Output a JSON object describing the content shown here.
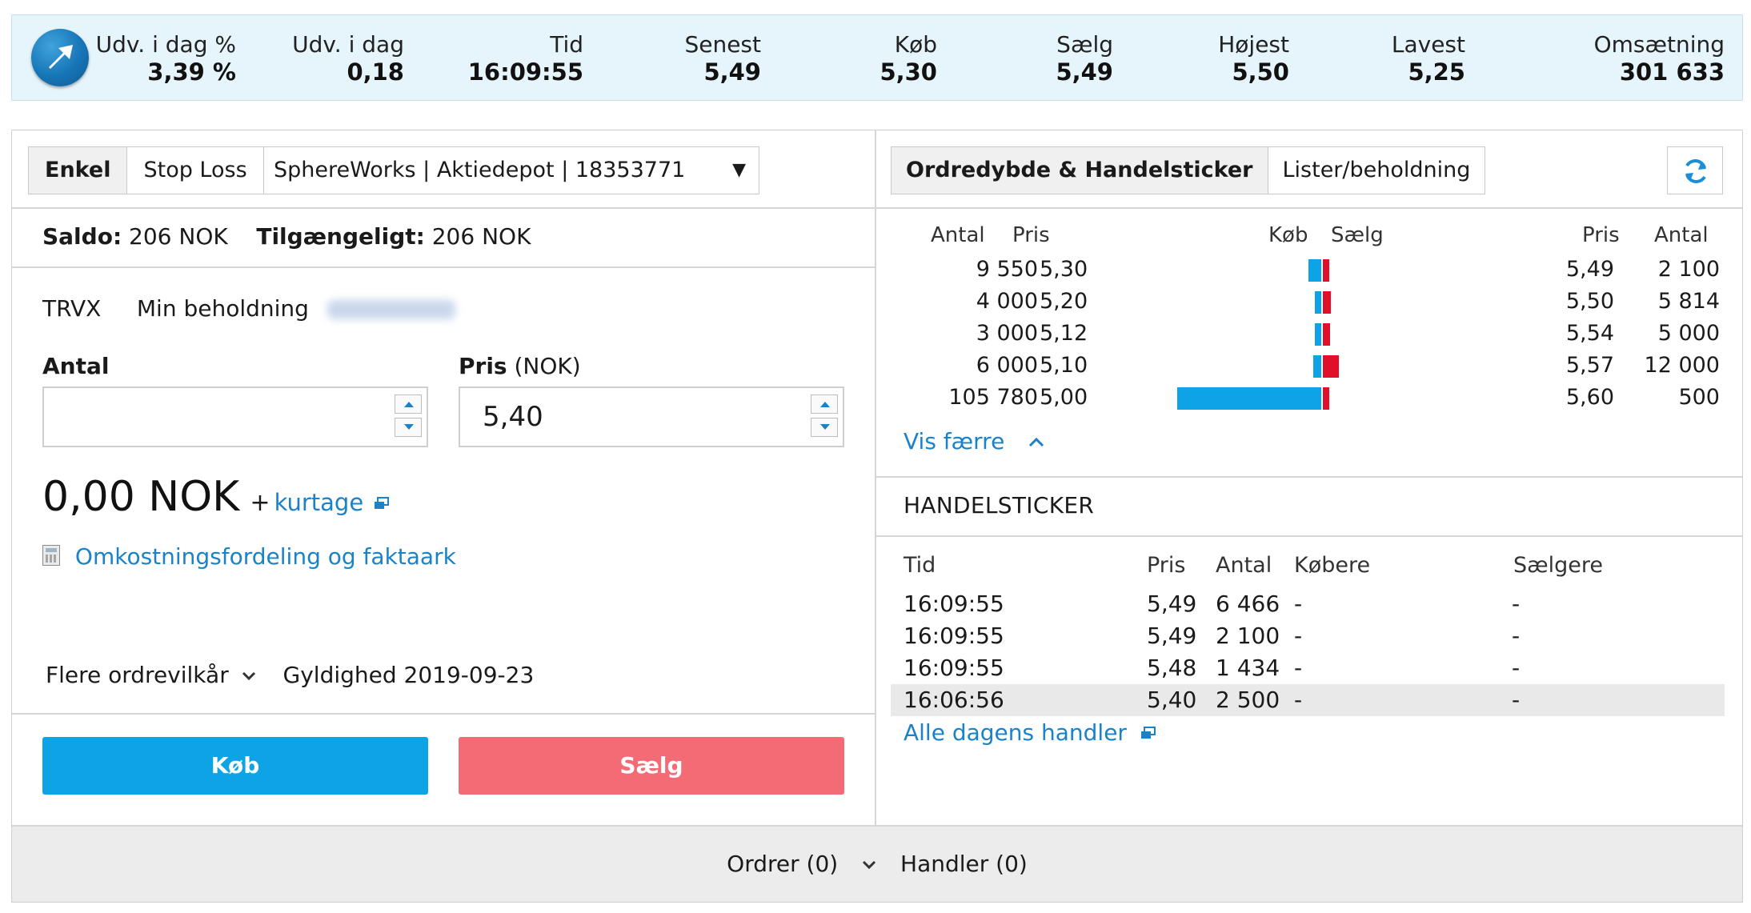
{
  "ticker": {
    "udv_pct_label": "Udv. i dag %",
    "udv_pct_value": "3,39 %",
    "udv_label": "Udv. i dag",
    "udv_value": "0,18",
    "tid_label": "Tid",
    "tid_value": "16:09:55",
    "senest_label": "Senest",
    "senest_value": "5,49",
    "kob_label": "Køb",
    "kob_value": "5,30",
    "saelg_label": "Sælg",
    "saelg_value": "5,49",
    "hojest_label": "Højest",
    "hojest_value": "5,50",
    "lavest_label": "Lavest",
    "lavest_value": "5,25",
    "oms_label": "Omsætning",
    "oms_value": "301 633",
    "trend_icon": "arrow-up-right-icon"
  },
  "order": {
    "tab_simple": "Enkel",
    "tab_stoploss": "Stop Loss",
    "account": "SphereWorks | Aktiedepot | 18353771",
    "saldo_label": "Saldo:",
    "saldo_value": "206 NOK",
    "tilg_label": "Tilgængeligt:",
    "tilg_value": "206 NOK",
    "symbol": "TRVX",
    "holding_label": "Min beholdning",
    "antal_label": "Antal",
    "antal_value": "",
    "pris_label": "Pris",
    "pris_unit": "(NOK)",
    "pris_value": "5,40",
    "total": "0,00 NOK",
    "plus": "+",
    "kurtage": "kurtage",
    "cost_link": "Omkostningsfordeling og faktaark",
    "more_terms": "Flere ordrevilkår",
    "validity": "Gyldighed 2019-09-23",
    "buy": "Køb",
    "sell": "Sælg"
  },
  "footer": {
    "orders": "Ordrer (0)",
    "trades": "Handler (0)"
  },
  "depth": {
    "tab_active": "Ordredybde & Handelsticker",
    "tab_other": "Lister/beholdning",
    "headers": {
      "antal_l": "Antal",
      "pris_l": "Pris",
      "kob": "Køb",
      "saelg": "Sælg",
      "pris_r": "Pris",
      "antal_r": "Antal"
    },
    "rows": [
      {
        "bid_qty": "9 550",
        "bid": "5,30",
        "ask": "5,49",
        "ask_qty": "2 100",
        "bid_n": 9550,
        "ask_n": 2100
      },
      {
        "bid_qty": "4 000",
        "bid": "5,20",
        "ask": "5,50",
        "ask_qty": "5 814",
        "bid_n": 4000,
        "ask_n": 5814
      },
      {
        "bid_qty": "3 000",
        "bid": "5,12",
        "ask": "5,54",
        "ask_qty": "5 000",
        "bid_n": 3000,
        "ask_n": 5000
      },
      {
        "bid_qty": "6 000",
        "bid": "5,10",
        "ask": "5,57",
        "ask_qty": "12 000",
        "bid_n": 6000,
        "ask_n": 12000
      },
      {
        "bid_qty": "105 780",
        "bid": "5,00",
        "ask": "5,60",
        "ask_qty": "500",
        "bid_n": 105780,
        "ask_n": 500
      }
    ],
    "bid_color": "#0ea3e4",
    "ask_color": "#e0102a",
    "show_less": "Vis færre"
  },
  "ticker_list": {
    "title": "HANDELSTICKER",
    "headers": {
      "tid": "Tid",
      "pris": "Pris",
      "antal": "Antal",
      "kobere": "Købere",
      "saelgere": "Sælgere"
    },
    "rows": [
      {
        "tid": "16:09:55",
        "pris": "5,49",
        "antal": "6 466",
        "kobere": "-",
        "saelgere": "-"
      },
      {
        "tid": "16:09:55",
        "pris": "5,49",
        "antal": "2 100",
        "kobere": "-",
        "saelgere": "-"
      },
      {
        "tid": "16:09:55",
        "pris": "5,48",
        "antal": "1 434",
        "kobere": "-",
        "saelgere": "-"
      },
      {
        "tid": "16:06:56",
        "pris": "5,40",
        "antal": "2 500",
        "kobere": "-",
        "saelgere": "-"
      }
    ],
    "all_link": "Alle dagens handler"
  }
}
